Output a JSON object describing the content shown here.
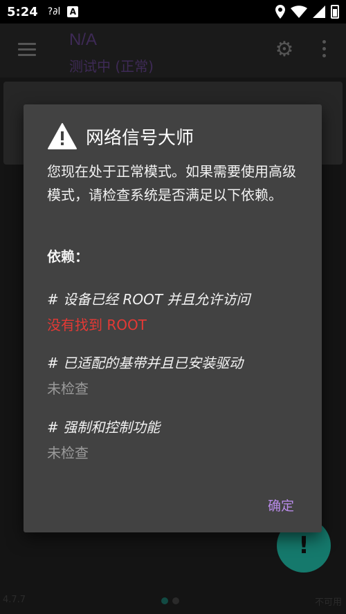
{
  "status_bar": {
    "time": "5:24",
    "signal": "?∂l",
    "badge": "A"
  },
  "app_bar": {
    "title": "N/A",
    "subtitle": "测试中 (正常)"
  },
  "bottom": {
    "version": "4.7.7",
    "unavailable": "不可用",
    "fab_label": "!"
  },
  "dialog": {
    "title": "网络信号大师",
    "message": "您现在处于正常模式。如果需要使用高级模式，请检查系统是否满足以下依赖。",
    "deps_label": "依赖：",
    "items": [
      {
        "title": "# 设备已经 ROOT 并且允许访问",
        "status": "没有找到 ROOT"
      },
      {
        "title": "# 已适配的基带并且已安装驱动",
        "status": "未检查"
      },
      {
        "title": "# 强制和控制功能",
        "status": "未检查"
      }
    ],
    "ok_label": "确定"
  },
  "colors": {
    "accent": "#b88be8",
    "error": "#e53935",
    "fab": "#15796c"
  }
}
